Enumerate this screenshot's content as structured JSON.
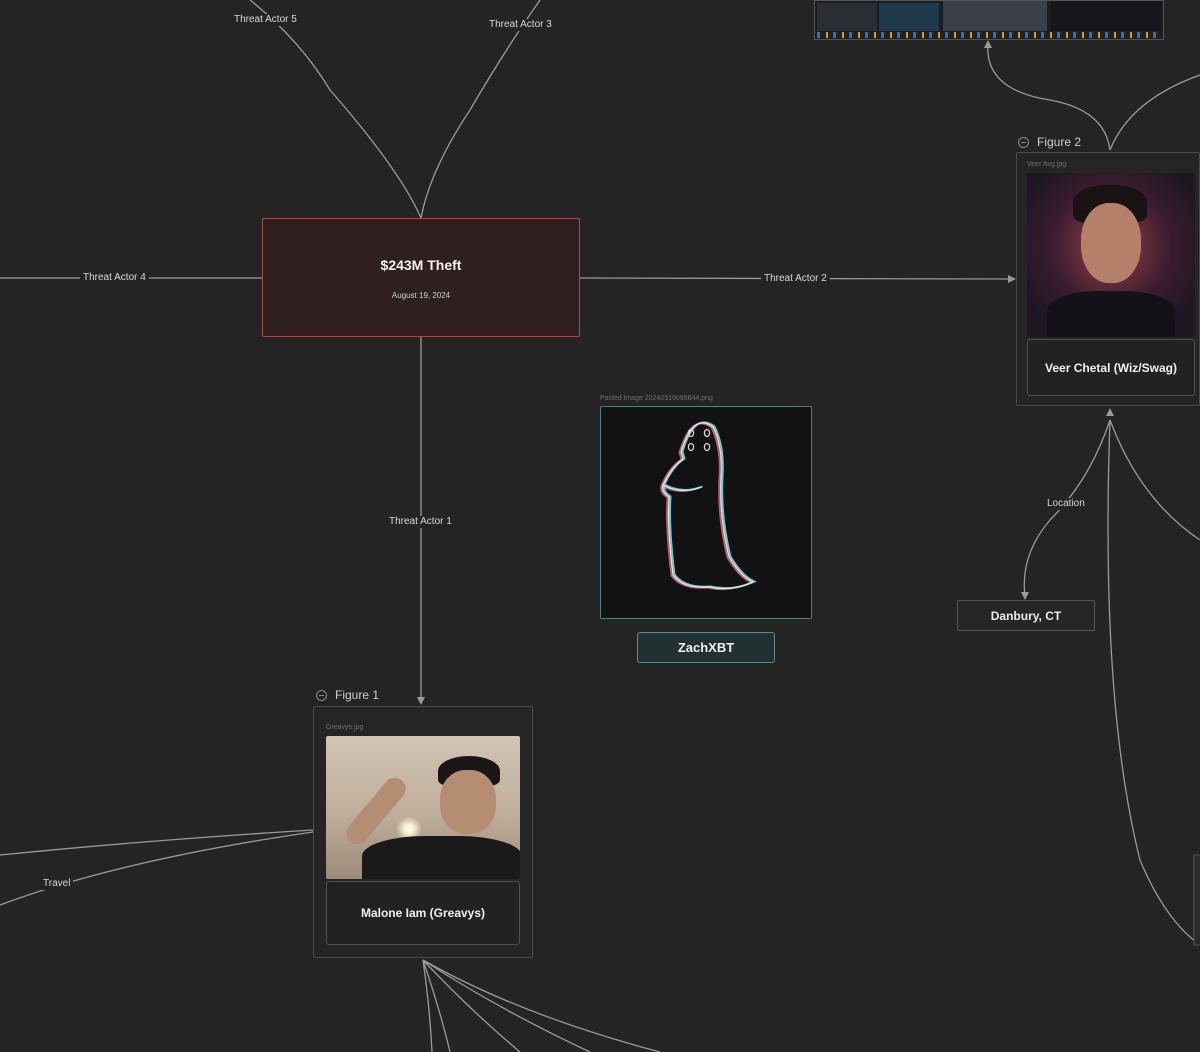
{
  "edges": {
    "threat_actor_5": "Threat Actor 5",
    "threat_actor_3": "Threat Actor 3",
    "threat_actor_4": "Threat Actor 4",
    "threat_actor_2": "Threat Actor 2",
    "threat_actor_1": "Threat Actor 1",
    "location": "Location",
    "travel": "Travel"
  },
  "theft_node": {
    "title": "$243M Theft",
    "date": "August 19, 2024"
  },
  "figure_1": {
    "header": "Figure 1",
    "filename": "Greavys.jpg",
    "name": "Malone Iam (Greavys)"
  },
  "figure_2": {
    "header": "Figure 2",
    "filename": "Veer Avg.jpg",
    "name": "Veer Chetal (Wiz/Swag)"
  },
  "pasted_image": {
    "filename": "Pasted image 20240919095844.png",
    "label": "ZachXBT"
  },
  "location_node": {
    "label": "Danbury, CT"
  },
  "colors": {
    "canvas": "#242424",
    "edge": "#9a9a9a",
    "theft_border": "#a54d47",
    "theft_fill": "#2f1f1f",
    "zach_border": "#5f8b8f"
  }
}
